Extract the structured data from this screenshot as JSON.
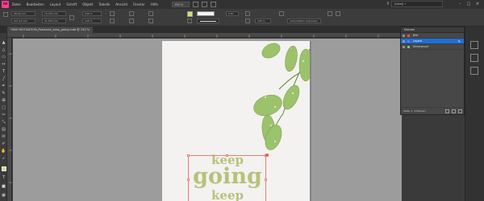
{
  "app": {
    "logo": "Id"
  },
  "menu": [
    "Datei",
    "Bearbeiten",
    "Layout",
    "Schrift",
    "Objekt",
    "Tabelle",
    "Ansicht",
    "Fenster",
    "Hilfe"
  ],
  "zoom": "100 %",
  "search": {
    "placeholder": "[Ideal] •"
  },
  "window_controls": [
    "–",
    "□",
    "×"
  ],
  "control": {
    "x": "28,56 mm",
    "y": "207,42 mm",
    "w": "70,783 mm",
    "h": "41,555 mm",
    "scale_x": "100 %",
    "scale_y": "100 %",
    "stroke_weight": "0 Pt",
    "fx": "100 %",
    "autofit_label": "Automatisch einpassen"
  },
  "tab": {
    "title": "*UNO·MOTIVATION_Postkarte_keep_going.indd @ 150 %"
  },
  "canvas": {
    "line1": "keep",
    "line2": "going",
    "line3": "keep"
  },
  "layers_panel": {
    "title": "Ebenen",
    "layers": [
      {
        "name": "Bild",
        "color": "#ff4c4c",
        "selected": false
      },
      {
        "name": "Layout",
        "color": "#4c7cff",
        "selected": true
      },
      {
        "name": "Hintergrund",
        "color": "#6ccf6c",
        "selected": false
      }
    ],
    "footer": "Seite: 1, 3 Ebenen"
  }
}
